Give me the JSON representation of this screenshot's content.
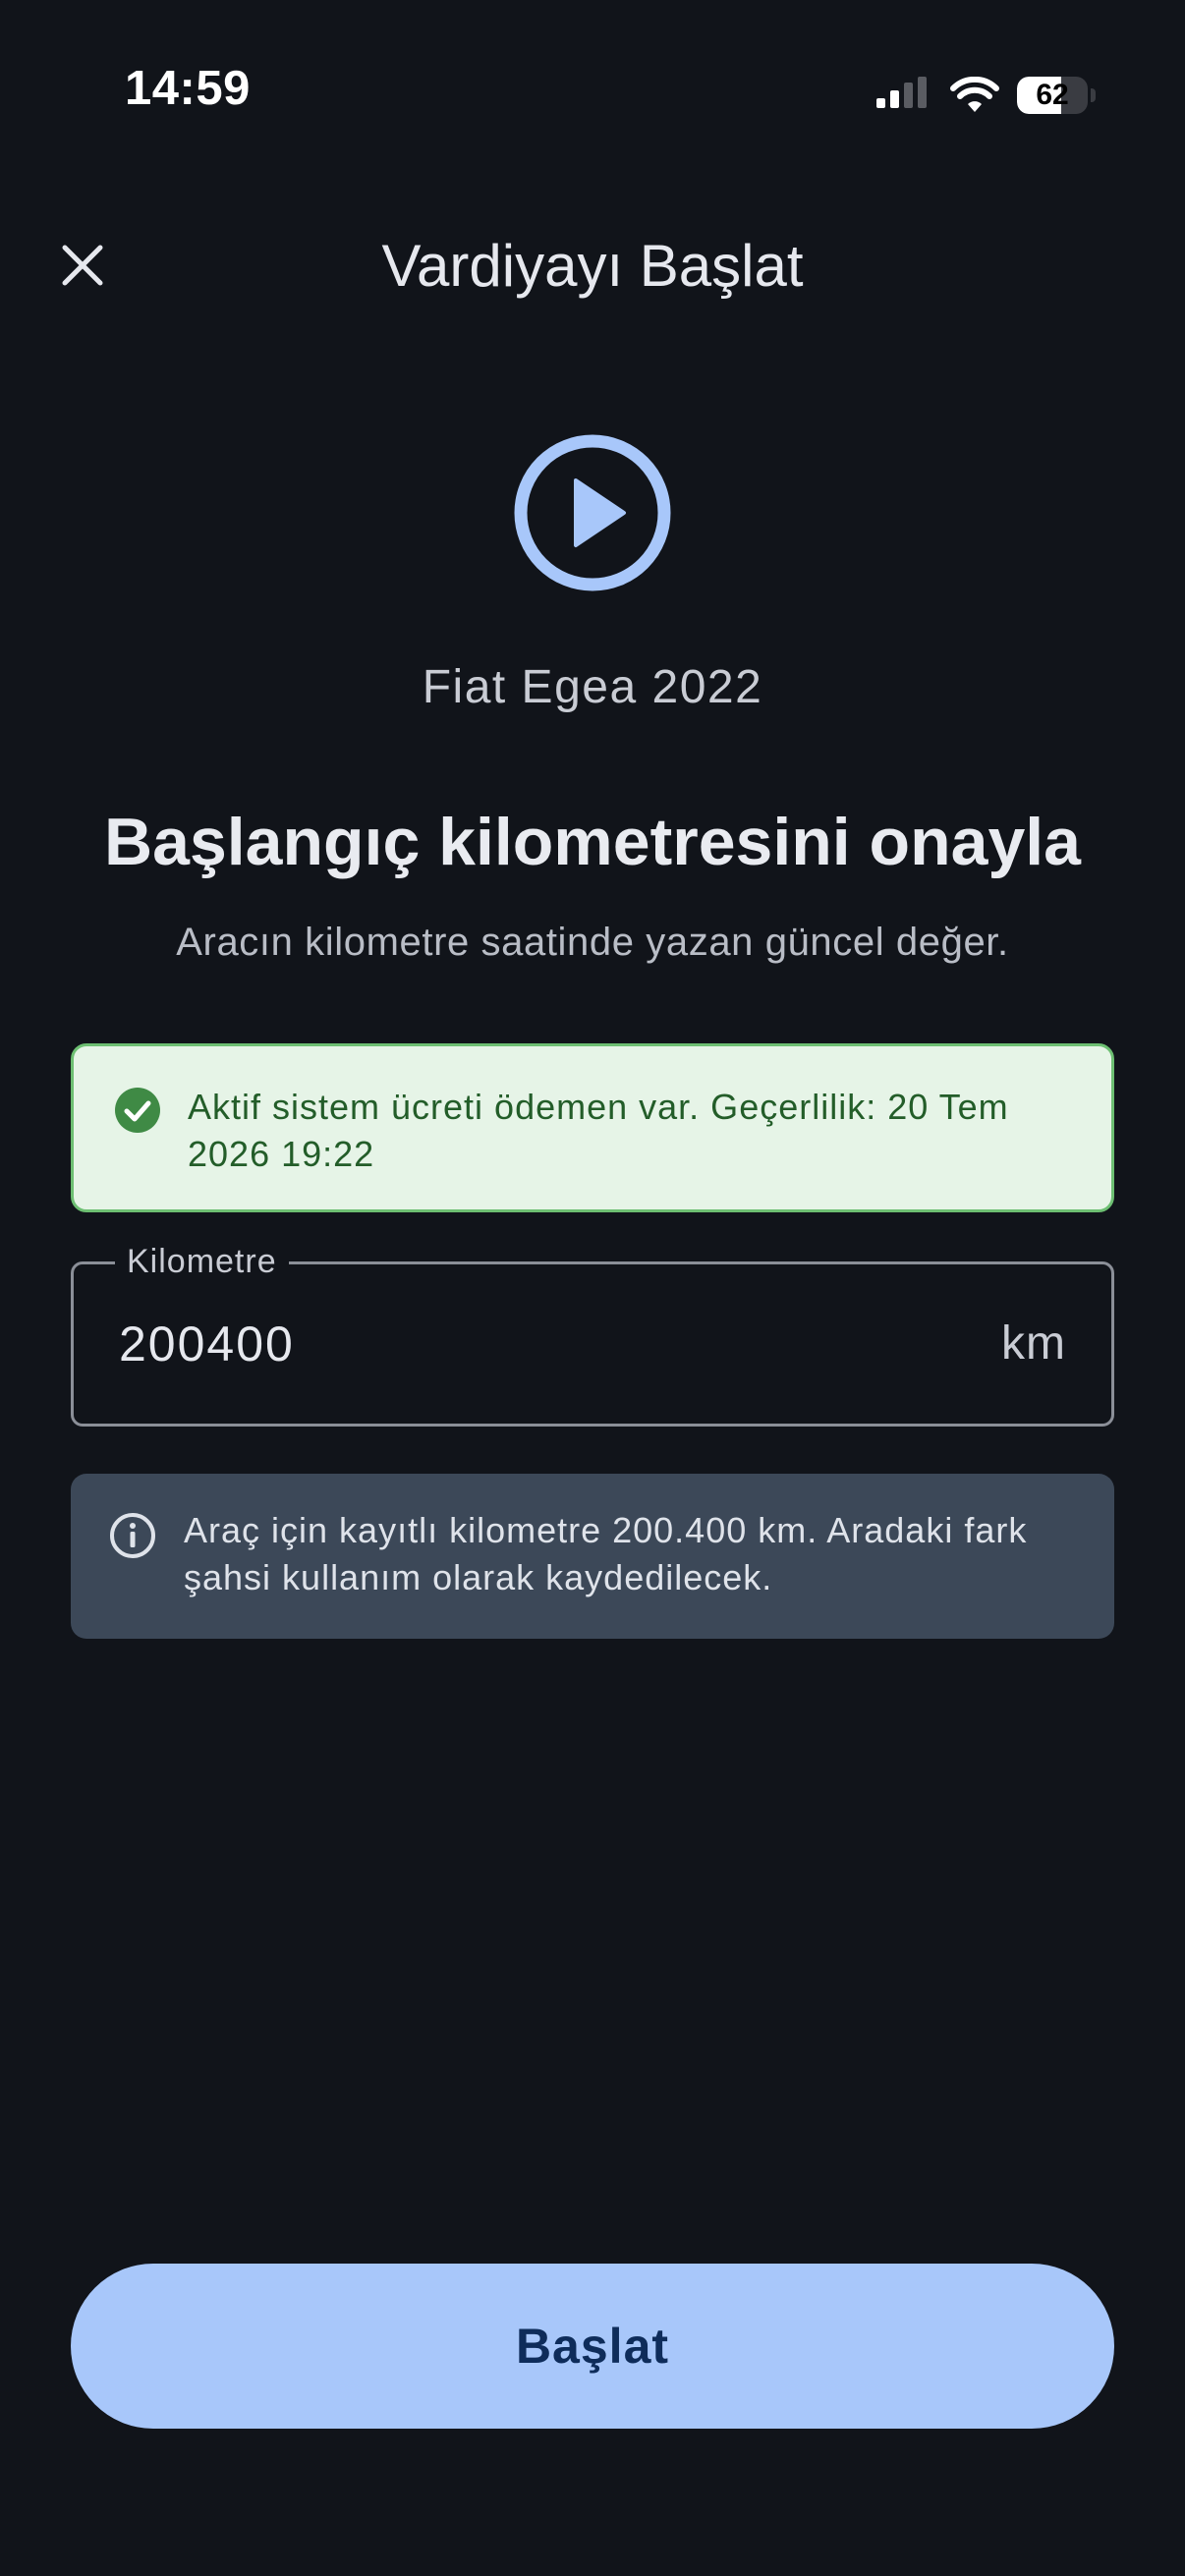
{
  "status_bar": {
    "time": "14:59",
    "battery_level": "62",
    "battery_fraction": 0.62,
    "icons": [
      "signal-icon",
      "wifi-icon",
      "battery-icon"
    ]
  },
  "header": {
    "title": "Vardiyayı Başlat",
    "close_icon": "close-icon"
  },
  "hero": {
    "icon": "play-circle-icon",
    "vehicle_name": "Fiat Egea 2022",
    "heading": "Başlangıç kilometresini onayla",
    "subheading": "Aracın kilometre saatinde yazan güncel değer."
  },
  "success_alert": {
    "icon": "check-circle-icon",
    "text": "Aktif sistem ücreti ödemen var. Geçerlilik: 20 Tem 2026 19:22"
  },
  "km_field": {
    "label": "Kilometre",
    "value": "200400",
    "unit": "km"
  },
  "info_alert": {
    "icon": "info-icon",
    "text": "Araç için kayıtlı kilometre 200.400 km. Aradaki fark şahsi kullanım olarak kaydedilecek."
  },
  "primary_button": {
    "label": "Başlat"
  },
  "colors": {
    "background": "#11141a",
    "accent": "#a8c7fa",
    "success_bg": "#e6f4e7",
    "success_border": "#6dbf72",
    "success_icon": "#3f8a45",
    "info_bg": "#3c4858"
  }
}
